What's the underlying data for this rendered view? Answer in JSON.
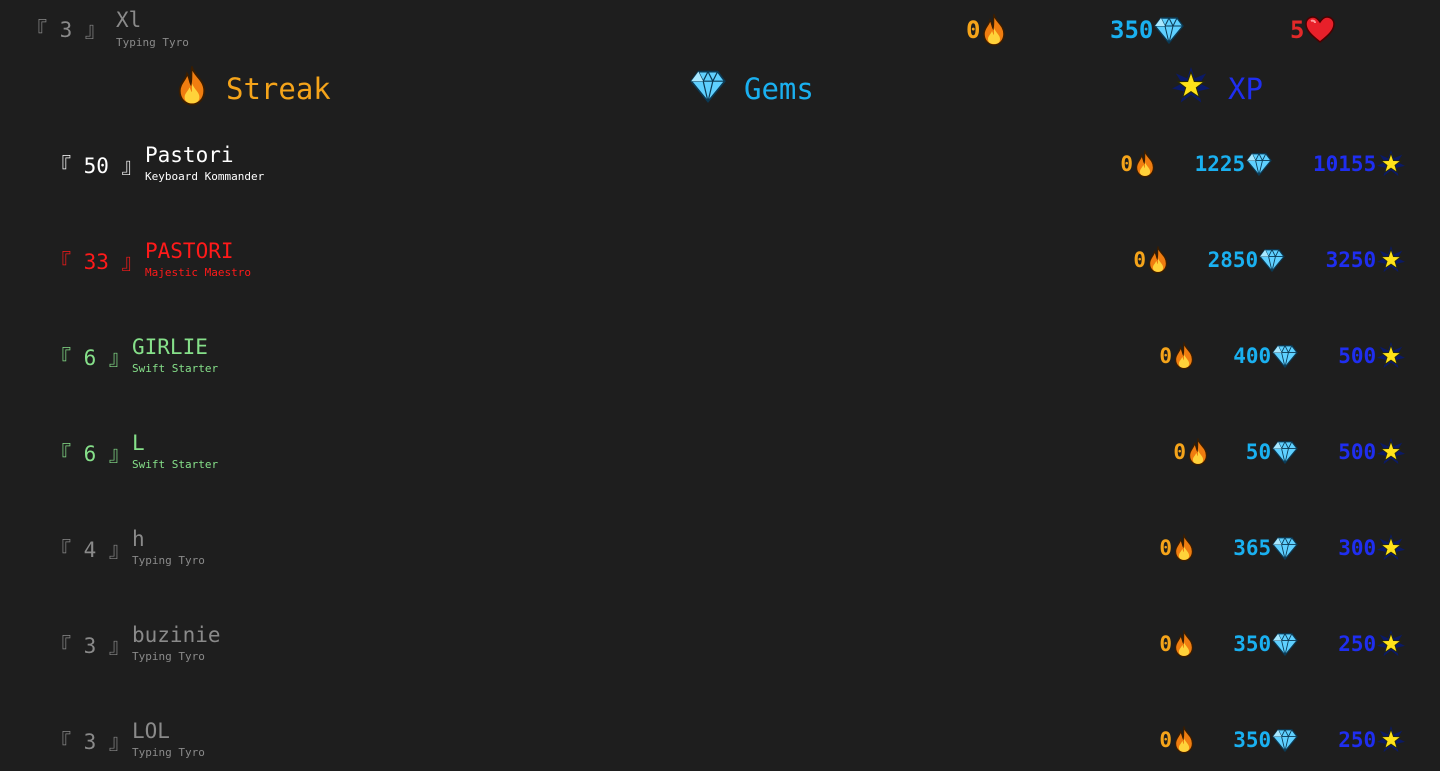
{
  "current_user": {
    "rank": "『 3 』",
    "name": "Xl",
    "title": "Typing Tyro",
    "streak": "0",
    "gems": "350",
    "hearts": "5"
  },
  "tabs": [
    {
      "label": "Streak",
      "icon": "fire-icon"
    },
    {
      "label": "Gems",
      "icon": "gem-icon"
    },
    {
      "label": "XP",
      "icon": "star-icon"
    }
  ],
  "colors": {
    "background": "#1e1e1e",
    "streak": "#f5a41a",
    "gems": "#1ab0f0",
    "xp": "#1f2ef0",
    "hearts": "#e32929",
    "rank_white": "#ffffff",
    "rank_red": "#ff1a1a",
    "rank_green": "#86e08a",
    "rank_gray": "#8a8a8a"
  },
  "leaderboard": [
    {
      "rank": "『 50 』",
      "name": "Pastori",
      "title": "Keyboard Kommander",
      "streak": "0",
      "gems": "1225",
      "xp": "10155",
      "tier": "white"
    },
    {
      "rank": "『 33 』",
      "name": "PASTORI",
      "title": "Majestic Maestro",
      "streak": "0",
      "gems": "2850",
      "xp": "3250",
      "tier": "red"
    },
    {
      "rank": "『 6 』",
      "name": "GIRLIE",
      "title": "Swift Starter",
      "streak": "0",
      "gems": "400",
      "xp": "500",
      "tier": "green"
    },
    {
      "rank": "『 6 』",
      "name": "L",
      "title": "Swift Starter",
      "streak": "0",
      "gems": "50",
      "xp": "500",
      "tier": "green"
    },
    {
      "rank": "『 4 』",
      "name": "h",
      "title": "Typing Tyro",
      "streak": "0",
      "gems": "365",
      "xp": "300",
      "tier": "gray"
    },
    {
      "rank": "『 3 』",
      "name": "buzinie",
      "title": "Typing Tyro",
      "streak": "0",
      "gems": "350",
      "xp": "250",
      "tier": "gray"
    },
    {
      "rank": "『 3 』",
      "name": "LOL",
      "title": "Typing Tyro",
      "streak": "0",
      "gems": "350",
      "xp": "250",
      "tier": "gray"
    }
  ]
}
